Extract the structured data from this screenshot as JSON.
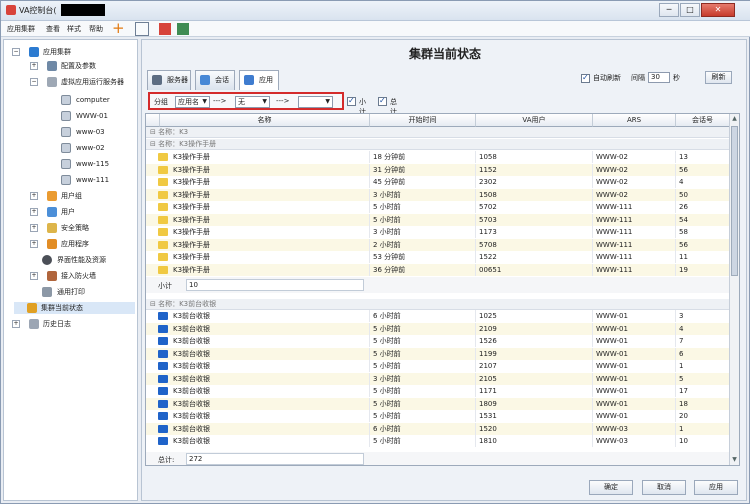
{
  "window": {
    "title": "VA控制台(",
    "minimize": "─",
    "maximize": "□",
    "close": "✕"
  },
  "menu": [
    "应用集群",
    "查看",
    "样式",
    "帮助"
  ],
  "sidebar": {
    "root": "应用集群",
    "items": [
      {
        "label": "配置及参数"
      },
      {
        "label": "虚拟应用运行服务器"
      },
      {
        "label": "computer"
      },
      {
        "label": "WWW-01"
      },
      {
        "label": "www-03"
      },
      {
        "label": "www-02"
      },
      {
        "label": "www-115"
      },
      {
        "label": "www-111"
      },
      {
        "label": "用户组"
      },
      {
        "label": "用户"
      },
      {
        "label": "安全策略"
      },
      {
        "label": "应用程序"
      },
      {
        "label": "界面性能及资源"
      },
      {
        "label": "接入防火墙"
      },
      {
        "label": "通用打印"
      },
      {
        "label": "集群当前状态"
      },
      {
        "label": "历史日志"
      }
    ]
  },
  "main": {
    "title": "集群当前状态",
    "tabs": [
      {
        "label": "服务器"
      },
      {
        "label": "会话"
      },
      {
        "label": "应用"
      }
    ],
    "options": {
      "auto_refresh": "自动刷新",
      "interval_label": "间隔",
      "interval_value": "30",
      "unit": "秒",
      "refresh": "刷新"
    },
    "grouping": {
      "label": "分组",
      "first": "应用名",
      "arrow1": "--->",
      "second": "无",
      "arrow2": "--->",
      "third": "",
      "subtotal": "小计",
      "total": "总计"
    },
    "columns": [
      "名称",
      "开始时间",
      "VA用户",
      "ARS",
      "会话号"
    ],
    "group_root": "名称：K3",
    "groups": [
      {
        "header": "名称：K3操作手册",
        "rows": [
          [
            "K3操作手册",
            "18 分钟前",
            "1058",
            "WWW-02",
            "13"
          ],
          [
            "K3操作手册",
            "31 分钟前",
            "1152",
            "WWW-02",
            "56"
          ],
          [
            "K3操作手册",
            "45 分钟前",
            "2302",
            "WWW-02",
            "4"
          ],
          [
            "K3操作手册",
            "3 小时前",
            "1508",
            "WWW-02",
            "50"
          ],
          [
            "K3操作手册",
            "5 小时前",
            "5702",
            "WWW-111",
            "26"
          ],
          [
            "K3操作手册",
            "5 小时前",
            "5703",
            "WWW-111",
            "54"
          ],
          [
            "K3操作手册",
            "3 小时前",
            "1173",
            "WWW-111",
            "58"
          ],
          [
            "K3操作手册",
            "2 小时前",
            "5708",
            "WWW-111",
            "56"
          ],
          [
            "K3操作手册",
            "53 分钟前",
            "1522",
            "WWW-111",
            "11"
          ],
          [
            "K3操作手册",
            "36 分钟前",
            "00651",
            "WWW-111",
            "19"
          ]
        ],
        "subtotal": "10"
      },
      {
        "header": "名称：K3前台收银",
        "rows": [
          [
            "K3前台收银",
            "6 小时前",
            "1025",
            "WWW-01",
            "3"
          ],
          [
            "K3前台收银",
            "5 小时前",
            "2109",
            "WWW-01",
            "4"
          ],
          [
            "K3前台收银",
            "5 小时前",
            "1526",
            "WWW-01",
            "7"
          ],
          [
            "K3前台收银",
            "5 小时前",
            "1199",
            "WWW-01",
            "6"
          ],
          [
            "K3前台收银",
            "5 小时前",
            "2107",
            "WWW-01",
            "1"
          ],
          [
            "K3前台收银",
            "3 小时前",
            "2105",
            "WWW-01",
            "5"
          ],
          [
            "K3前台收银",
            "5 小时前",
            "1171",
            "WWW-01",
            "17"
          ],
          [
            "K3前台收银",
            "5 小时前",
            "1809",
            "WWW-01",
            "18"
          ],
          [
            "K3前台收银",
            "5 小时前",
            "1531",
            "WWW-01",
            "20"
          ],
          [
            "K3前台收银",
            "6 小时前",
            "1520",
            "WWW-03",
            "1"
          ],
          [
            "K3前台收银",
            "5 小时前",
            "1810",
            "WWW-03",
            "10"
          ]
        ]
      }
    ],
    "total_label": "总计:",
    "total_value": "272",
    "buttons": {
      "ok": "确定",
      "cancel": "取消",
      "apply": "应用"
    }
  }
}
